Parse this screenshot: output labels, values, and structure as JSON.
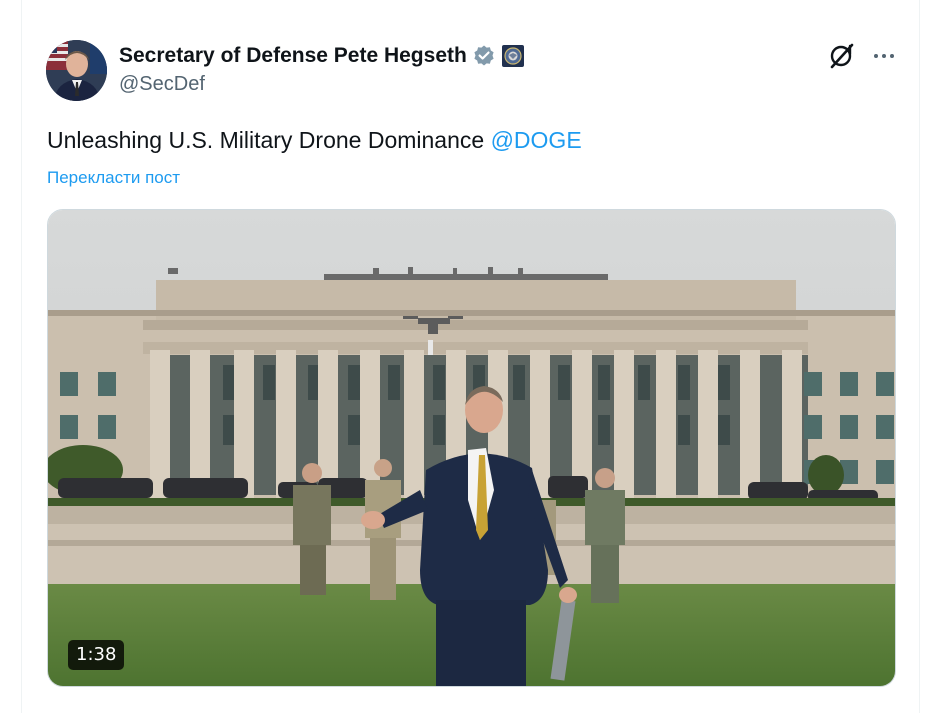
{
  "tweet": {
    "display_name": "Secretary of Defense Pete Hegseth",
    "handle": "@SecDef",
    "text": "Unleashing U.S. Military Drone Dominance ",
    "mention": "@DOGE",
    "translate_label": "Перекласти пост"
  },
  "media": {
    "duration": "1:38"
  },
  "icons": {
    "verified": "verified-badge-icon",
    "affiliation": "department-of-defense-seal-icon",
    "grok": "grok-icon",
    "more": "more-options-icon"
  },
  "colors": {
    "accent": "#1d9bf0",
    "text": "#0f1419",
    "secondary": "#536471"
  }
}
